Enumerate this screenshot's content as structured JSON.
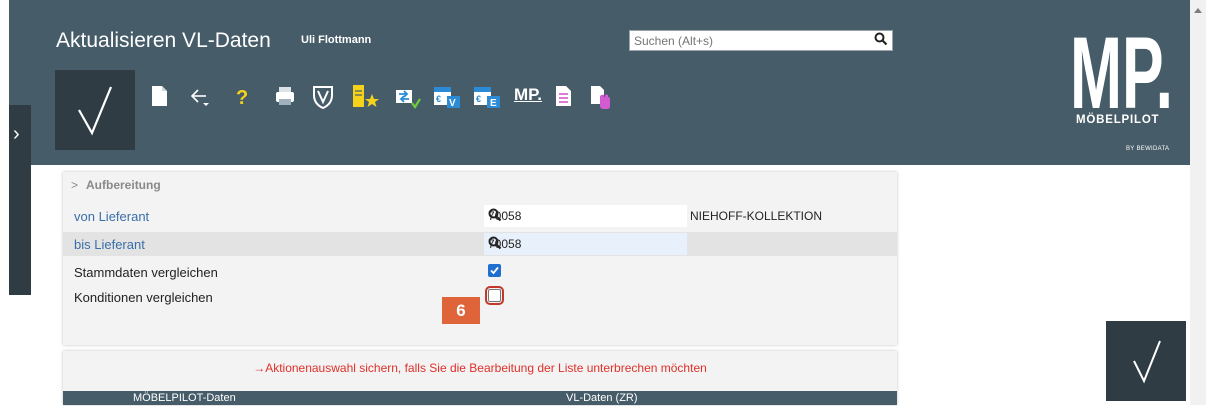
{
  "header": {
    "title": "Aktualisieren VL-Daten",
    "user": "Uli Flottmann",
    "search_placeholder": "Suchen (Alt+s)"
  },
  "toolbar": {
    "icons": [
      "new-document-icon",
      "back-icon",
      "help-icon",
      "print-icon",
      "shield-icon",
      "bookmark-star-icon",
      "transfer-icon",
      "calendar-v-icon",
      "calendar-e-icon",
      "mp-icon",
      "list-document-icon",
      "hand-document-icon"
    ],
    "mp_label": "MP."
  },
  "logo": {
    "mark": "MP.",
    "name": "MÖBELPILOT",
    "by": "BY BEWIDATA"
  },
  "section": {
    "title": "Aufbereitung"
  },
  "form": {
    "von_label": "von Lieferant",
    "von_value": "70058",
    "von_name": "NIEHOFF-KOLLEKTION",
    "bis_label": "bis Lieferant",
    "bis_value": "70058",
    "stamm_label": "Stammdaten vergleichen",
    "stamm_checked": true,
    "kond_label": "Konditionen vergleichen",
    "kond_checked": false
  },
  "step_badge": "6",
  "notice": "→Aktionenauswahl sichern, falls Sie die Bearbeitung der Liste unterbrechen möchten",
  "table": {
    "columns": [
      "MÖBELPILOT-Daten",
      "VL-Daten (ZR)"
    ]
  },
  "colors": {
    "header_bg": "#465c68",
    "dark_button": "#2f3c44",
    "link": "#3a6fa8",
    "accent_badge": "#e0643a",
    "warning_text": "#e0302a",
    "checkbox_on": "#1f6fd1"
  }
}
